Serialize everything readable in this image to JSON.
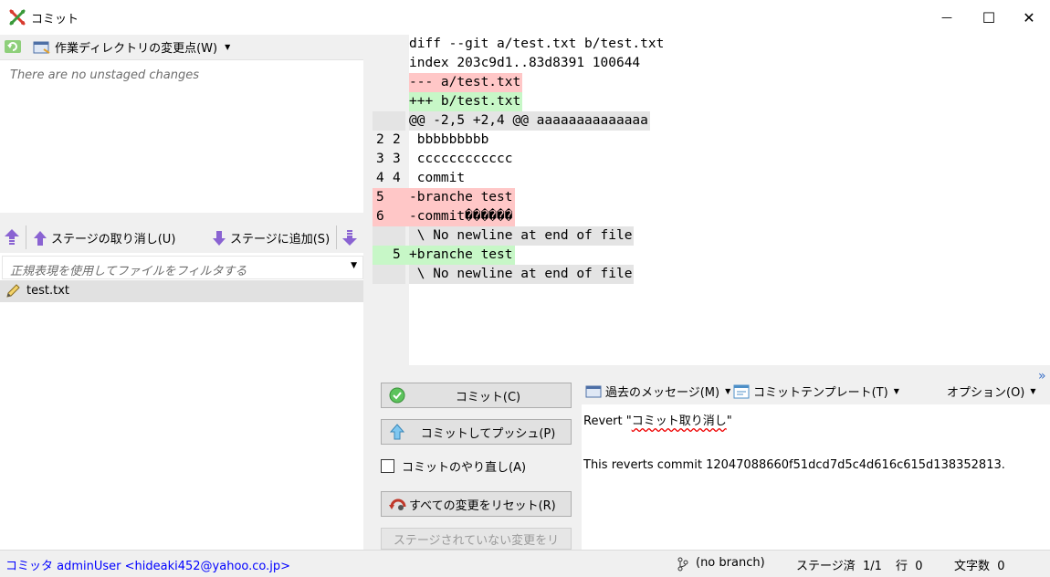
{
  "window": {
    "title": "コミット",
    "minimize_glyph": "—",
    "maximize_glyph": "☐",
    "close_glyph": "✕"
  },
  "unstaged": {
    "dropdown_label": "作業ディレクトリの変更点(W)",
    "empty_text": "There are no unstaged changes"
  },
  "staging": {
    "unstage_label": "ステージの取り消し(U)",
    "stage_label": "ステージに追加(S)",
    "filter_placeholder": "正規表現を使用してファイルをフィルタする",
    "files": [
      {
        "name": "test.txt",
        "icon": "pencil-icon"
      }
    ]
  },
  "diff": {
    "lines": [
      {
        "old": "",
        "new": "",
        "text": "diff --git a/test.txt b/test.txt",
        "type": "header"
      },
      {
        "old": "",
        "new": "",
        "text": "index 203c9d1..83d8391 100644",
        "type": "header"
      },
      {
        "old": "",
        "new": "",
        "text": "--- a/test.txt",
        "type": "del"
      },
      {
        "old": "",
        "new": "",
        "text": "+++ b/test.txt",
        "type": "add"
      },
      {
        "old": "",
        "new": "",
        "text": "@@ -2,5 +2,4 @@ aaaaaaaaaaaaaa",
        "type": "meta"
      },
      {
        "old": "2",
        "new": "2",
        "text": " bbbbbbbbb",
        "type": "context"
      },
      {
        "old": "3",
        "new": "3",
        "text": " cccccccccccc",
        "type": "context"
      },
      {
        "old": "4",
        "new": "4",
        "text": " commit",
        "type": "context"
      },
      {
        "old": "5",
        "new": "",
        "text": "-branche test",
        "type": "del"
      },
      {
        "old": "6",
        "new": "",
        "text": "-commit������",
        "type": "del"
      },
      {
        "old": "",
        "new": "",
        "text": " \\ No newline at end of file",
        "type": "meta"
      },
      {
        "old": "",
        "new": "5",
        "text": "+branche test",
        "type": "add"
      },
      {
        "old": "",
        "new": "",
        "text": " \\ No newline at end of file",
        "type": "meta"
      }
    ]
  },
  "commit": {
    "commit_button": "コミット(C)",
    "commit_push_button": "コミットしてプッシュ(P)",
    "amend_label": "コミットのやり直し(A)",
    "amend_checked": false,
    "reset_all_button": "すべての変更をリセット(R)",
    "reset_unstaged_button": "ステージされていない変更をリ",
    "past_messages": "過去のメッセージ(M)",
    "templates": "コミットテンプレート(T)",
    "options": "オプション(O)",
    "overflow_glyph": "»",
    "message_prefix": "Revert \"",
    "message_quoted": "コミット取り消し",
    "message_suffix": "\"",
    "message_body": "This reverts commit 12047088660f51dcd7d5c4d616c615d138352813."
  },
  "status": {
    "committer": "コミッタ adminUser <hideaki452@yahoo.co.jp>",
    "branch": "(no branch)",
    "staged": "ステージ済  1/1",
    "line": "行  0",
    "chars": "文字数  0"
  },
  "colors": {
    "diff_del_bg": "#ffc7c7",
    "diff_add_bg": "#c7f7c7",
    "diff_meta_bg": "#e4e4e4",
    "committer_text": "#0000ff",
    "app_icon_red": "#d83b2f",
    "app_icon_green": "#3a9a3a"
  }
}
